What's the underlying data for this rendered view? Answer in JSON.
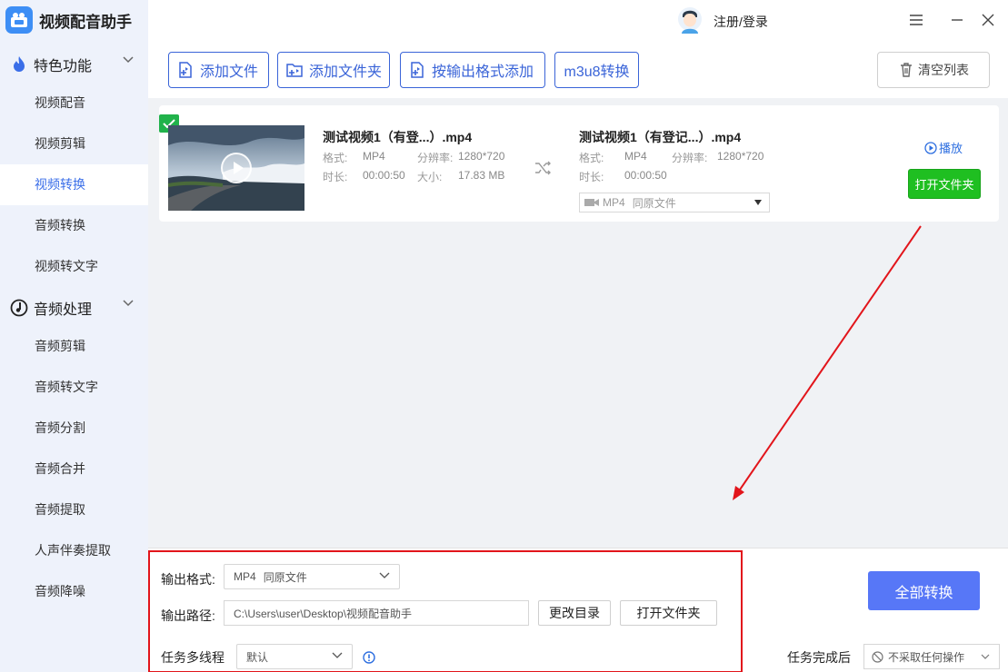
{
  "app": {
    "name": "视频配音助手",
    "logo_icon": "camera-icon"
  },
  "sidebar": {
    "group1": {
      "label": "特色功能",
      "icon": "flame-icon"
    },
    "group1_items": [
      {
        "label": "视频配音"
      },
      {
        "label": "视频剪辑"
      },
      {
        "label": "视频转换",
        "active": true
      },
      {
        "label": "音频转换"
      },
      {
        "label": "视频转文字"
      }
    ],
    "group2": {
      "label": "音频处理",
      "icon": "music-note-icon"
    },
    "group2_items": [
      {
        "label": "音频剪辑"
      },
      {
        "label": "音频转文字"
      },
      {
        "label": "音频分割"
      },
      {
        "label": "音频合并"
      },
      {
        "label": "音频提取"
      },
      {
        "label": "人声伴奏提取"
      },
      {
        "label": "音频降噪"
      }
    ]
  },
  "header": {
    "login": "注册/登录"
  },
  "toolbar": {
    "add_file": "添加文件",
    "add_folder": "添加文件夹",
    "add_by_format": "按输出格式添加",
    "m3u8": "m3u8转换",
    "clear": "清空列表"
  },
  "file": {
    "source": {
      "name": "测试视频1（有登...）.mp4",
      "format_label": "格式:",
      "format": "MP4",
      "resolution_label": "分辨率:",
      "resolution": "1280*720",
      "duration_label": "时长:",
      "duration": "00:00:50",
      "size_label": "大小:",
      "size": "17.83 MB"
    },
    "output": {
      "name": "测试视频1（有登记...）.mp4",
      "format_label": "格式:",
      "format": "MP4",
      "resolution_label": "分辨率:",
      "resolution": "1280*720",
      "duration_label": "时长:",
      "duration": "00:00:50",
      "select_format": "MP4",
      "select_quality": "同原文件"
    },
    "play": "播放",
    "open_folder": "打开文件夹"
  },
  "bottom": {
    "output_format_label": "输出格式:",
    "output_format_value": "MP4",
    "output_format_quality": "同原文件",
    "output_path_label": "输出路径:",
    "output_path": "C:\\Users\\user\\Desktop\\视频配音助手",
    "change_dir": "更改目录",
    "open_folder": "打开文件夹",
    "multithread_label": "任务多线程",
    "multithread_value": "默认",
    "convert_all": "全部转换",
    "after_label": "任务完成后",
    "after_value": "不采取任何操作"
  },
  "colors": {
    "accent": "#3a64d8",
    "convert_button": "#5777f7",
    "open_folder_green": "#1fbf21",
    "annotation_red": "#e2151b",
    "check_green": "#21b24b"
  }
}
